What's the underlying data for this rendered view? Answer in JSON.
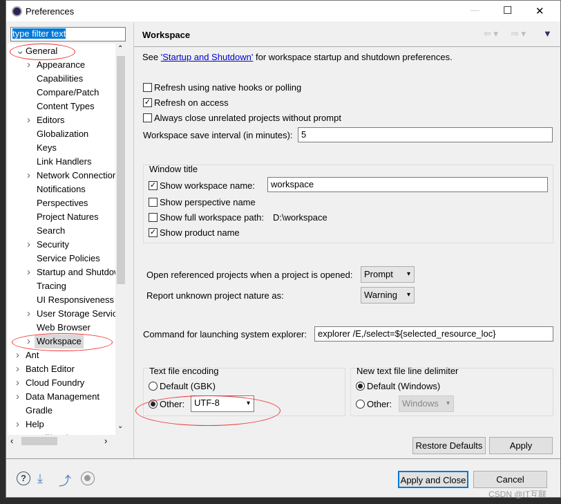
{
  "window": {
    "title": "Preferences",
    "minimize": "—",
    "maximize": "☐",
    "close": "✕"
  },
  "filter": {
    "value": "type filter text"
  },
  "tree": {
    "items": [
      {
        "label": "General",
        "level": 0,
        "expanded": true
      },
      {
        "label": "Appearance",
        "level": 1,
        "arrow": true
      },
      {
        "label": "Capabilities",
        "level": 1
      },
      {
        "label": "Compare/Patch",
        "level": 1
      },
      {
        "label": "Content Types",
        "level": 1
      },
      {
        "label": "Editors",
        "level": 1,
        "arrow": true
      },
      {
        "label": "Globalization",
        "level": 1
      },
      {
        "label": "Keys",
        "level": 1
      },
      {
        "label": "Link Handlers",
        "level": 1
      },
      {
        "label": "Network Connections",
        "level": 1,
        "arrow": true
      },
      {
        "label": "Notifications",
        "level": 1
      },
      {
        "label": "Perspectives",
        "level": 1
      },
      {
        "label": "Project Natures",
        "level": 1
      },
      {
        "label": "Search",
        "level": 1
      },
      {
        "label": "Security",
        "level": 1,
        "arrow": true
      },
      {
        "label": "Service Policies",
        "level": 1
      },
      {
        "label": "Startup and Shutdown",
        "level": 1,
        "arrow": true
      },
      {
        "label": "Tracing",
        "level": 1
      },
      {
        "label": "UI Responsiveness",
        "level": 1
      },
      {
        "label": "User Storage Service",
        "level": 1,
        "arrow": true
      },
      {
        "label": "Web Browser",
        "level": 1
      },
      {
        "label": "Workspace",
        "level": 1,
        "arrow": true,
        "selected": true
      },
      {
        "label": "Ant",
        "level": 0,
        "arrow": true
      },
      {
        "label": "Batch Editor",
        "level": 0,
        "arrow": true
      },
      {
        "label": "Cloud Foundry",
        "level": 0,
        "arrow": true
      },
      {
        "label": "Data Management",
        "level": 0,
        "arrow": true
      },
      {
        "label": "Gradle",
        "level": 0
      },
      {
        "label": "Help",
        "level": 0,
        "arrow": true
      },
      {
        "label": "Install/Update",
        "level": 0,
        "arrow": true
      }
    ]
  },
  "page": {
    "title": "Workspace",
    "intro_pre": "See ",
    "intro_link": "'Startup and Shutdown'",
    "intro_post": " for workspace startup and shutdown preferences.",
    "refresh_native": {
      "label": "Refresh using native hooks or polling",
      "checked": false
    },
    "refresh_access": {
      "label": "Refresh on access",
      "checked": true
    },
    "always_close": {
      "label": "Always close unrelated projects without prompt",
      "checked": false
    },
    "save_interval": {
      "label": "Workspace save interval (in minutes):",
      "value": "5"
    },
    "window_title": {
      "legend": "Window title",
      "show_ws_name": {
        "label": "Show workspace name:",
        "checked": true,
        "value": "workspace"
      },
      "show_persp": {
        "label": "Show perspective name",
        "checked": false
      },
      "show_path": {
        "label": "Show full workspace path:",
        "checked": false,
        "value": "D:\\workspace"
      },
      "show_product": {
        "label": "Show product name",
        "checked": true
      }
    },
    "open_ref": {
      "label": "Open referenced projects when a project is opened:",
      "value": "Prompt"
    },
    "unknown_nature": {
      "label": "Report unknown project nature as:",
      "value": "Warning"
    },
    "explorer": {
      "label": "Command for launching system explorer:",
      "value": "explorer /E,/select=${selected_resource_loc}"
    },
    "encoding": {
      "legend": "Text file encoding",
      "default_label": "Default (GBK)",
      "other_label": "Other:",
      "other_value": "UTF-8",
      "selected": "other"
    },
    "delimiter": {
      "legend": "New text file line delimiter",
      "default_label": "Default (Windows)",
      "other_label": "Other:",
      "other_value": "Windows",
      "selected": "default"
    },
    "restore": "Restore Defaults",
    "apply": "Apply"
  },
  "footer": {
    "apply_close": "Apply and Close",
    "cancel": "Cancel",
    "watermark": "CSDN @IT互联"
  },
  "colors": {
    "accent": "#0078d7",
    "annotation": "#e33333",
    "link": "#0000cc"
  }
}
